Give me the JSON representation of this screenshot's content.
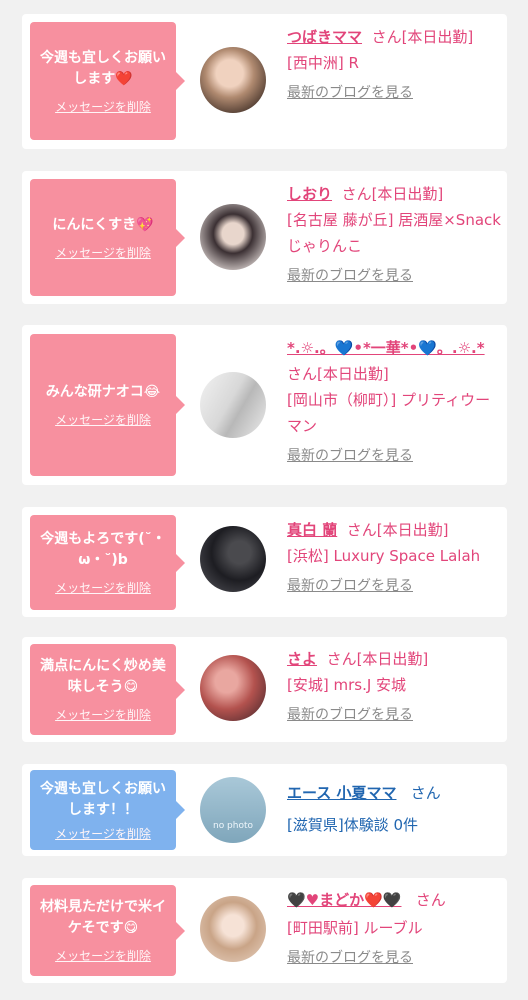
{
  "cards": [
    {
      "message": "今週も宜しくお願いします❤️",
      "delete_label": "メッセージを削除",
      "name": "つばきママ",
      "san": "さん",
      "status": "[本日出勤]",
      "shop": "[西中洲] R",
      "blog": "最新のブログを見る",
      "bubble_color": "pink"
    },
    {
      "message": "にんにくすき💖",
      "delete_label": "メッセージを削除",
      "name": "しおり",
      "san": "さん",
      "status": "[本日出勤]",
      "shop": "[名古屋 藤が丘] 居酒屋×Snack じゃりんこ",
      "blog": "最新のブログを見る",
      "bubble_color": "pink"
    },
    {
      "message": "みんな研ナオコ😂",
      "delete_label": "メッセージを削除",
      "name": "*.☼.。💙•*一華*•💙。.☼.*",
      "san": "さん",
      "status": "[本日出勤]",
      "shop": "[岡山市（柳町）] プリティウーマン",
      "blog": "最新のブログを見る",
      "bubble_color": "pink"
    },
    {
      "message": "今週もよろです(˘・ω・˘)b",
      "delete_label": "メッセージを削除",
      "name": "真白 蘭",
      "san": "さん",
      "status": "[本日出勤]",
      "shop": "[浜松] Luxury Space Lalah",
      "blog": "最新のブログを見る",
      "bubble_color": "pink"
    },
    {
      "message": "満点にんにく炒め美味しそう😋",
      "delete_label": "メッセージを削除",
      "name": "さよ",
      "san": "さん",
      "status": "[本日出勤]",
      "shop": "[安城] mrs.J 安城",
      "blog": "最新のブログを見る",
      "bubble_color": "pink"
    },
    {
      "message": "今週も宜しくお願いします！！",
      "delete_label": "メッセージを削除",
      "name": "エース 小夏ママ",
      "san": "さん",
      "status": "",
      "shop": "[滋賀県]体験談 0件",
      "blog": "",
      "bubble_color": "blue",
      "avatar_text": "no photo"
    },
    {
      "message": "材料見ただけで米イケそです😋",
      "delete_label": "メッセージを削除",
      "name": "🖤♥まどか❤️🖤",
      "san": "さん",
      "status": "",
      "shop": "[町田駅前] ルーブル",
      "blog": "最新のブログを見る",
      "bubble_color": "pink"
    }
  ],
  "colors": {
    "pink": "#f7909f",
    "blue": "#7fb2ee",
    "name_pink": "#e2457a",
    "name_blue": "#2166b0"
  }
}
